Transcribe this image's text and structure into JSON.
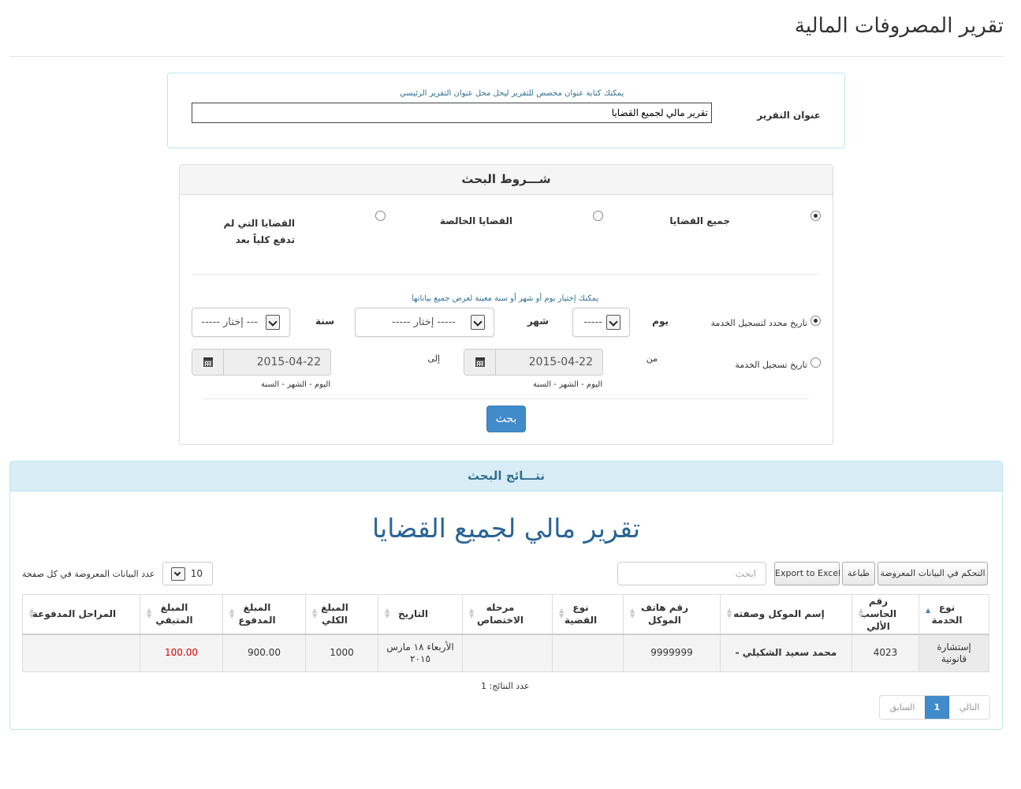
{
  "page": {
    "title": "تقرير المصروفات المالية"
  },
  "report_title_section": {
    "label": "عنوان التقرير",
    "hint": "يمكنك كتابة عنوان مخصص للتقرير ليحل محل عنوان التقرير الرئيسي",
    "value": "تقرير مالي لجميع القضايا"
  },
  "search": {
    "title": "شـــروط البحث",
    "case_filters": [
      {
        "label": "جميع القضايا",
        "checked": true
      },
      {
        "label": "القضايا الخالصة",
        "checked": false
      },
      {
        "label": "القضايا التي لم تدفع كلياً بعد",
        "checked": false
      }
    ],
    "date_hint": "يمكنك إختيار يوم أو شهر أو سنة معينة لعرض جميع بياناتها",
    "specific_date": {
      "label": "تاريخ محدد لتسجيل الخدمة",
      "checked": true,
      "day_label": "يوم",
      "day_value": "-----",
      "month_label": "شهر",
      "month_value": "----- إختار -----",
      "year_label": "سنة",
      "year_value": "--- إختار -----"
    },
    "date_range": {
      "label": "تاريخ تسجيل الخدمة",
      "checked": false,
      "from_label": "من",
      "from_value": "2015-04-22",
      "to_label": "إلى",
      "to_value": "2015-04-22",
      "format_hint": "اليوم - الشهر - السنة"
    },
    "submit_label": "بحث"
  },
  "results": {
    "title": "نتـــائج البحث",
    "report_heading": "تقرير مالي لجميع القضايا",
    "buttons": {
      "columns": "التحكم في البيانات المعروضة",
      "print": "طباعة",
      "excel": "Export to Excel"
    },
    "search_placeholder": "ابحث",
    "page_length_value": "10",
    "page_length_label": "عدد البيانات المعروضة في كل صفحة",
    "columns": [
      "نوع الخدمة",
      "رقم الحاسب الألي",
      "إسم الموكل وصفته",
      "رقم هاتف الموكل",
      "نوع القضية",
      "مرحله الاختصاص",
      "التاريخ",
      "المبلغ الكلي",
      "المبلغ المدفوع",
      "المبلغ المتبقي",
      "المراحل المدفوعة"
    ],
    "rows": [
      {
        "service_type": "إستشارة قانونية",
        "computer_no": "4023",
        "client": "محمد سعيد الشكيلي -",
        "phone": "9999999",
        "case_type": "",
        "stage": "",
        "date": "الأربعاء ١٨ مارس ٢٠١٥",
        "total": "1000",
        "paid": "900.00",
        "remaining": "100.00",
        "paid_stages": ""
      }
    ],
    "count_text": "عدد النتائج: 1",
    "pagination": {
      "next": "التالي",
      "current": "1",
      "prev": "السابق"
    }
  }
}
